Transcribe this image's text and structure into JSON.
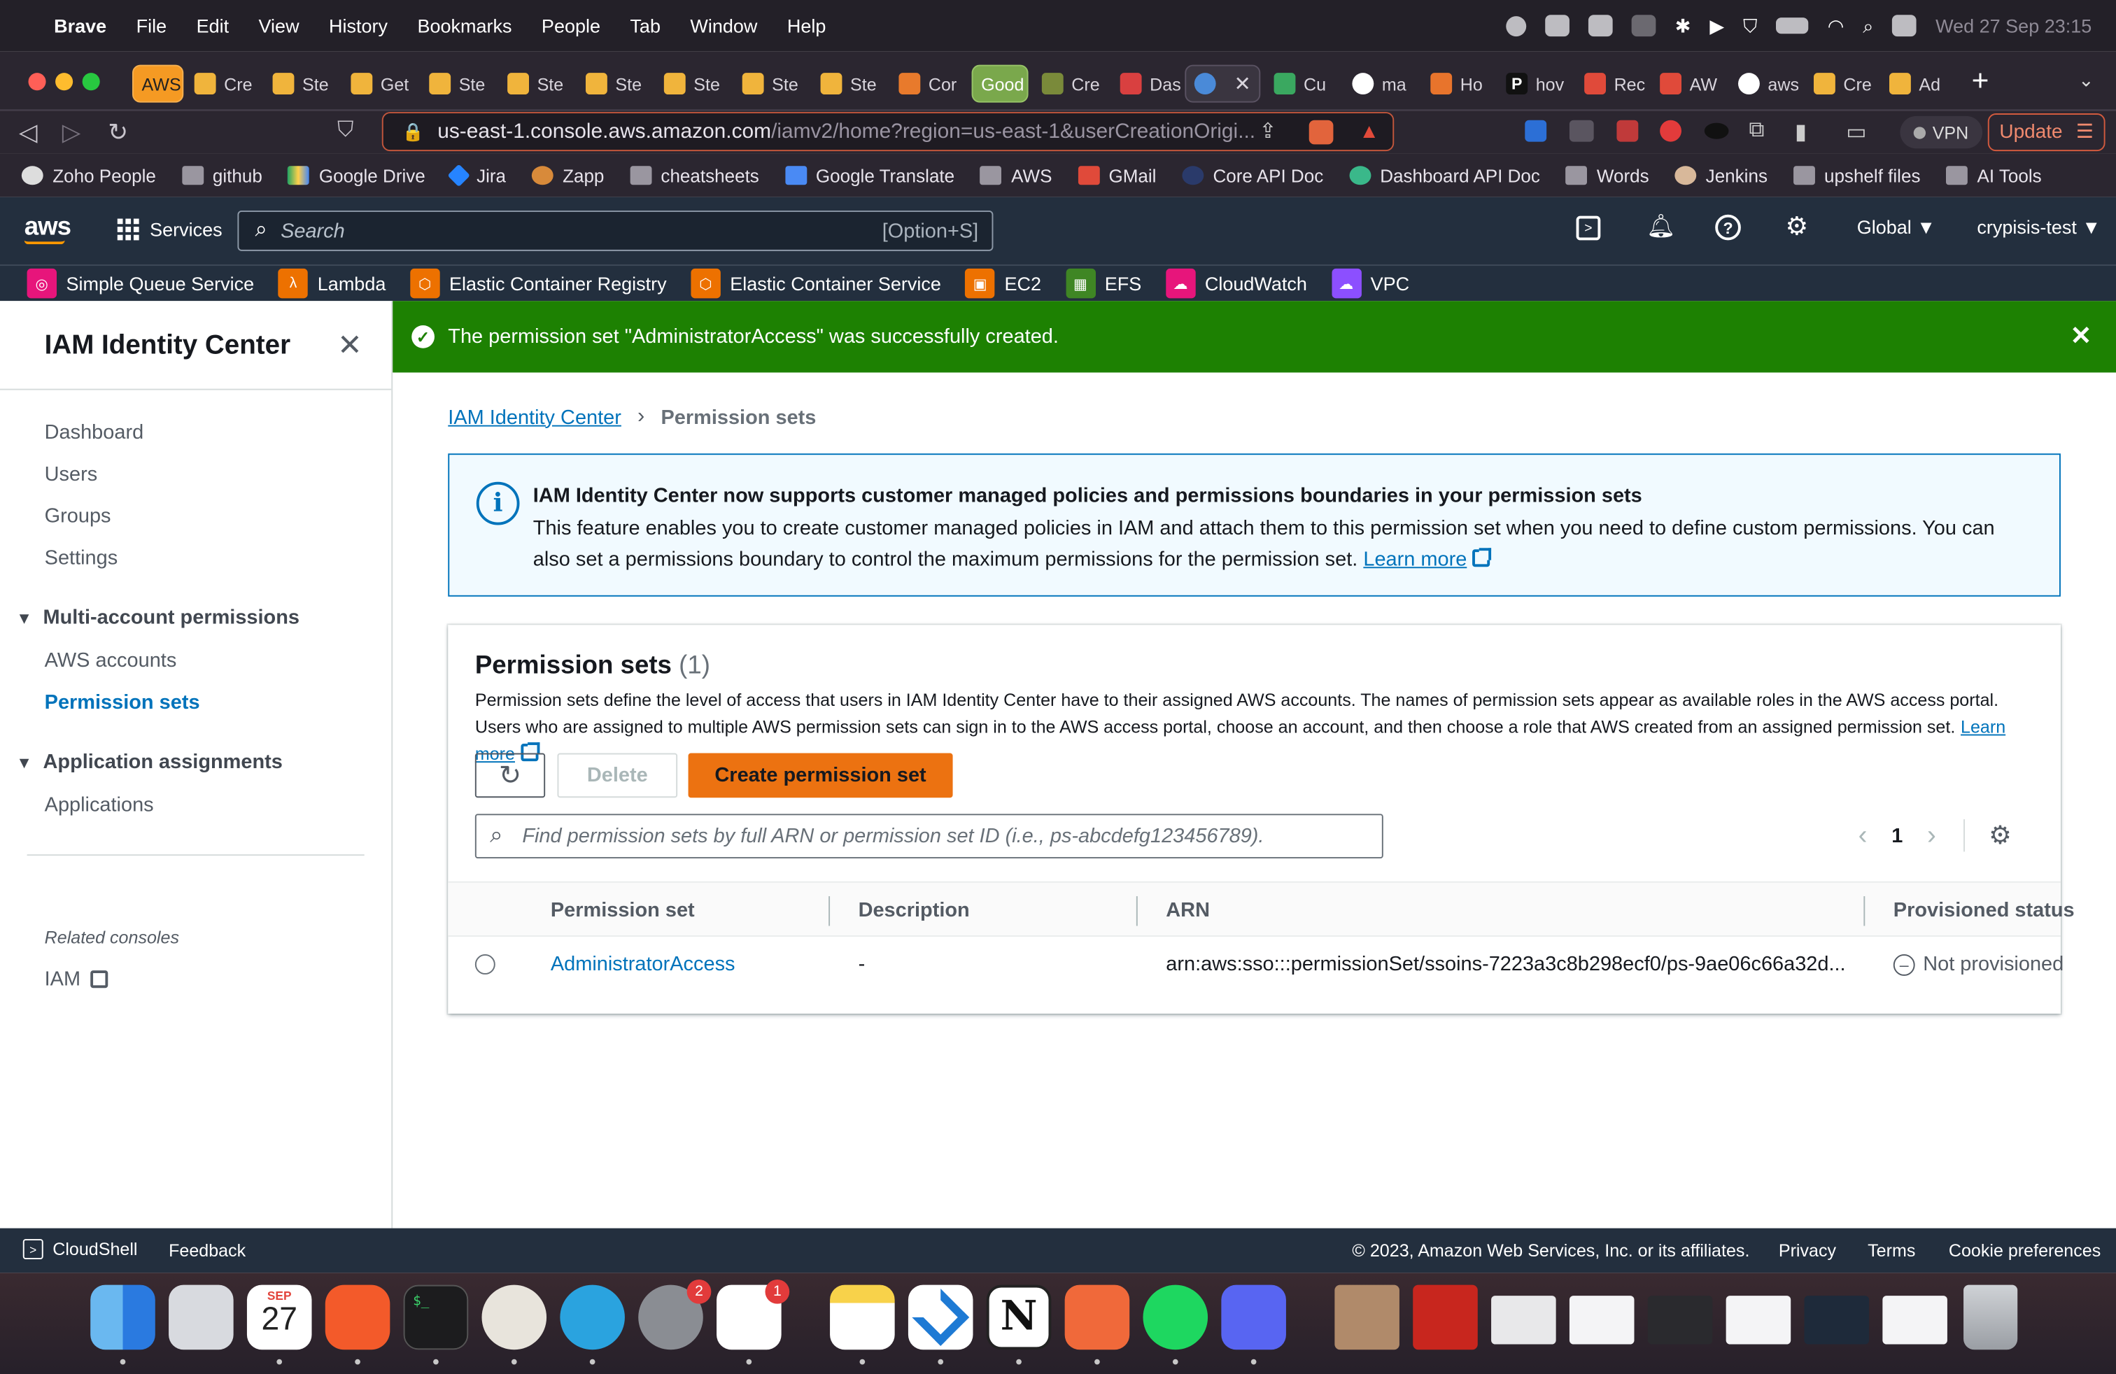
{
  "menubar": {
    "app": "Brave",
    "items": [
      "File",
      "Edit",
      "View",
      "History",
      "Bookmarks",
      "People",
      "Tab",
      "Window",
      "Help"
    ],
    "datetime": "Wed 27 Sep  23:15"
  },
  "tabs": [
    "AWS",
    "Cre",
    "Ste",
    "Get",
    "Ste",
    "Ste",
    "Ste",
    "Ste",
    "Ste",
    "Ste",
    "Cor",
    "Good",
    "Cre",
    "Das",
    "",
    "Cu",
    "ma",
    "Ho",
    "hov",
    "Rec",
    "AW",
    "aws",
    "Cre",
    "Ad"
  ],
  "address": {
    "host": "us-east-1.console.aws.amazon.com",
    "path": "/iamv2/home?region=us-east-1&userCreationOrigi...",
    "vpn": "VPN",
    "update": "Update"
  },
  "bookmarks": [
    "Zoho People",
    "github",
    "Google Drive",
    "Jira",
    "Zapp",
    "cheatsheets",
    "Google Translate",
    "AWS",
    "GMail",
    "Core API Doc",
    "Dashboard API Doc",
    "Words",
    "Jenkins",
    "upshelf files",
    "AI Tools"
  ],
  "aws_header": {
    "services": "Services",
    "search_placeholder": "Search",
    "search_hint": "[Option+S]",
    "region": "Global ▼",
    "account": "crypisis-test ▼"
  },
  "services_bar": [
    "Simple Queue Service",
    "Lambda",
    "Elastic Container Registry",
    "Elastic Container Service",
    "EC2",
    "EFS",
    "CloudWatch",
    "VPC"
  ],
  "sidebar": {
    "title": "IAM Identity Center",
    "items": [
      "Dashboard",
      "Users",
      "Groups",
      "Settings"
    ],
    "section1": "Multi-account permissions",
    "section1_items": [
      "AWS accounts",
      "Permission sets"
    ],
    "section2": "Application assignments",
    "section2_items": [
      "Applications"
    ],
    "related": "Related consoles",
    "iam": "IAM"
  },
  "banner": {
    "message": "The permission set \"AdministratorAccess\" was successfully created."
  },
  "breadcrumb": {
    "root": "IAM Identity Center",
    "current": "Permission sets"
  },
  "info": {
    "heading": "IAM Identity Center now supports customer managed policies and permissions boundaries in your permission sets",
    "body": "This feature enables you to create customer managed policies in IAM and attach them to this permission set when you need to define custom permissions. You can also set a permissions boundary to control the maximum permissions for the permission set.",
    "learn_more": "Learn more"
  },
  "permission_sets": {
    "title": "Permission sets",
    "count": "(1)",
    "description": "Permission sets define the level of access that users in IAM Identity Center have to their assigned AWS accounts. The names of permission sets appear as available roles in the AWS access portal. Users who are assigned to multiple AWS permission sets can sign in to the AWS access portal, choose an account, and then choose a role that AWS created from an assigned permission set.",
    "learn_more": "Learn more",
    "delete": "Delete",
    "create": "Create permission set",
    "filter_placeholder": "Find permission sets by full ARN or permission set ID (i.e., ps-abcdefg123456789).",
    "page": "1",
    "columns": [
      "Permission set",
      "Description",
      "ARN",
      "Provisioned status"
    ],
    "rows": [
      {
        "name": "AdministratorAccess",
        "description": "-",
        "arn": "arn:aws:sso:::permissionSet/ssoins-7223a3c8b298ecf0/ps-9ae06c66a32d...",
        "status": "Not provisioned"
      }
    ]
  },
  "footer": {
    "cloudshell": "CloudShell",
    "feedback": "Feedback",
    "copyright": "© 2023, Amazon Web Services, Inc. or its affiliates.",
    "privacy": "Privacy",
    "terms": "Terms",
    "cookies": "Cookie preferences"
  },
  "dock": {
    "calendar_month": "SEP",
    "calendar_day": "27",
    "badge_settings": "2",
    "badge_slack": "1"
  },
  "colors": {
    "aws_nav": "#232f3e",
    "success": "#1d8102",
    "primary_button": "#ec7211",
    "link": "#0073bb"
  }
}
